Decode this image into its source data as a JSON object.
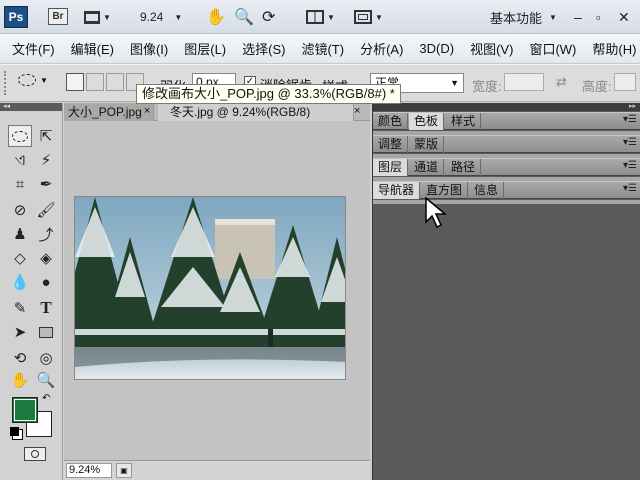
{
  "app": {
    "logo": "Ps",
    "bridge": "Br",
    "zoom": "9.24",
    "workspace": "基本功能",
    "window_minimize": "–",
    "window_restore": "▫"
  },
  "menu": [
    "文件(F)",
    "编辑(E)",
    "图像(I)",
    "图层(L)",
    "选择(S)",
    "滤镜(T)",
    "分析(A)",
    "3D(D)",
    "视图(V)",
    "窗口(W)",
    "帮助(H)"
  ],
  "options": {
    "feather_label": "羽化:",
    "feather_value": "0 px",
    "antialias_label": "消除锯齿",
    "style_label": "样式:",
    "style_value": "正常",
    "width_label": "宽度:",
    "height_label": "高度:"
  },
  "tooltip": "修改画布大小_POP.jpg @ 33.3%(RGB/8#) *",
  "doc_tabs": [
    {
      "label": "大小_POP.jpg"
    },
    {
      "label": "冬天.jpg @ 9.24%(RGB/8)"
    }
  ],
  "status": {
    "zoom": "9.24%"
  },
  "panels": {
    "group1": [
      "颜色",
      "色板",
      "样式"
    ],
    "group2": [
      "调整",
      "蒙版"
    ],
    "group3": [
      "图层",
      "通道",
      "路径"
    ],
    "group4": [
      "导航器",
      "直方图",
      "信息"
    ]
  },
  "colors": {
    "foreground": "#1d7a3e",
    "background": "#ffffff"
  }
}
